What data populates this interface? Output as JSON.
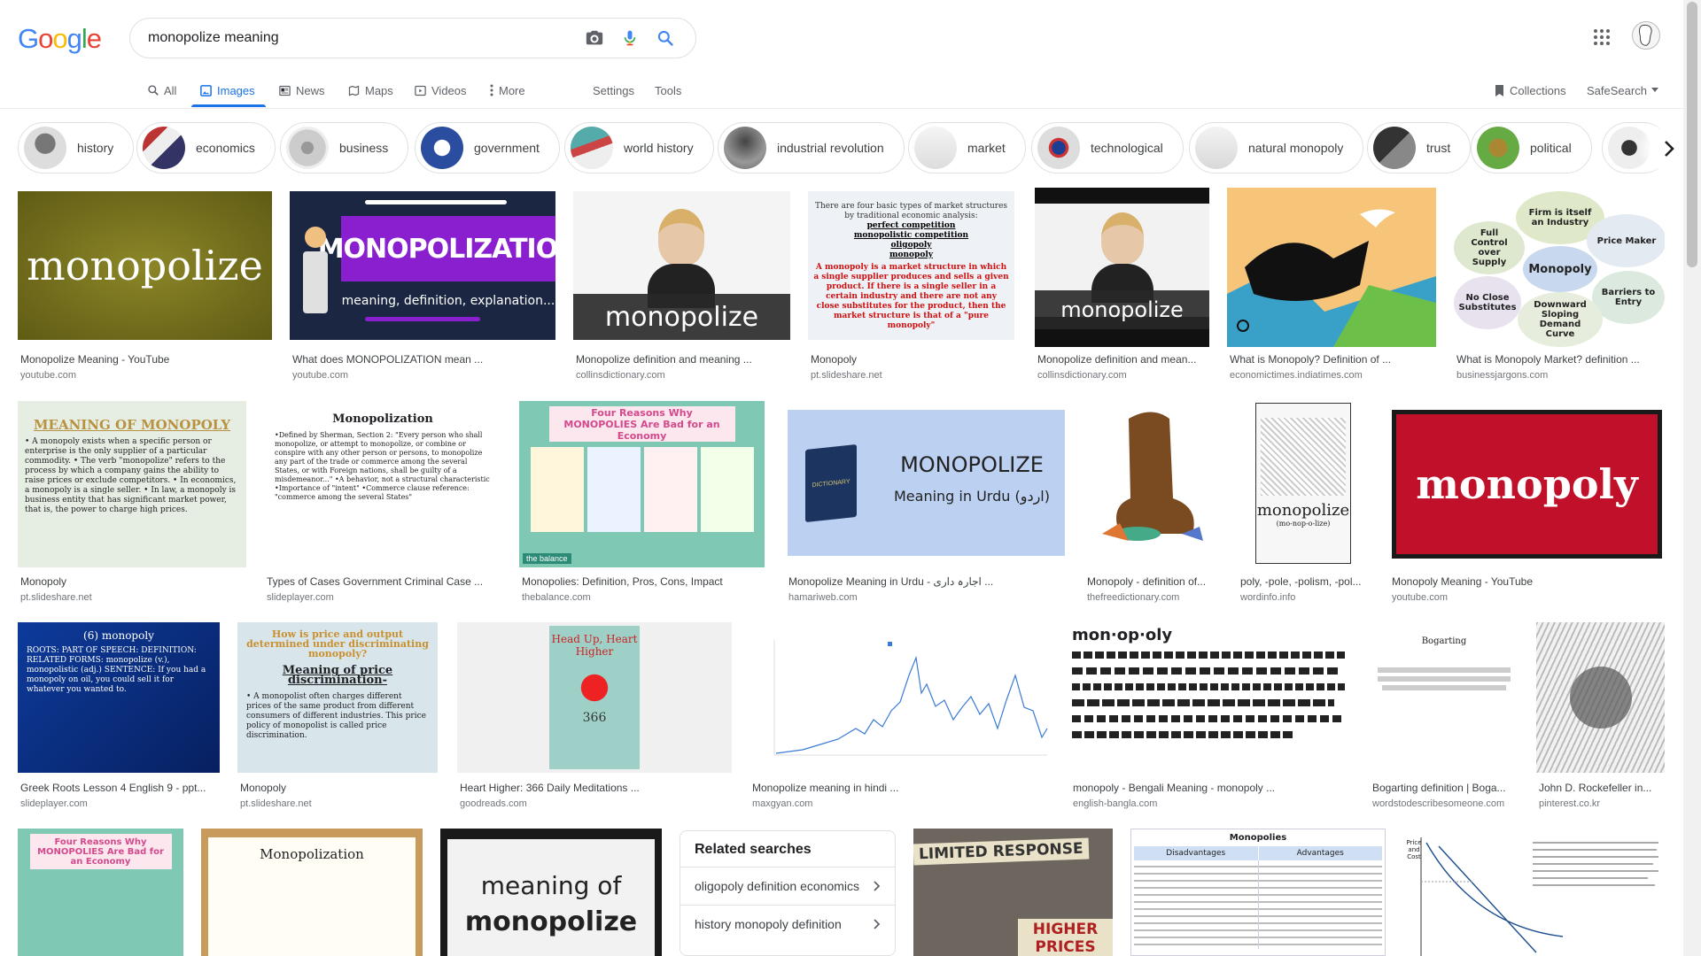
{
  "logo": {
    "text": "Google"
  },
  "search": {
    "query": "monopolize meaning"
  },
  "tabs": {
    "all": "All",
    "images": "Images",
    "news": "News",
    "maps": "Maps",
    "videos": "Videos",
    "more": "More",
    "settings": "Settings",
    "tools": "Tools",
    "collections": "Collections",
    "safesearch": "SafeSearch"
  },
  "chips": [
    "history",
    "economics",
    "business",
    "government",
    "world history",
    "industrial revolution",
    "market",
    "technological",
    "natural monopoly",
    "trust",
    "political"
  ],
  "results": [
    {
      "title": "Monopolize Meaning - YouTube",
      "domain": "youtube.com",
      "caption": "monopolize"
    },
    {
      "title": "What does MONOPOLIZATION mean ...",
      "domain": "youtube.com",
      "caption": "MONOPOLIZATION",
      "sub": "meaning, definition, explanation..."
    },
    {
      "title": "Monopolize definition and meaning ...",
      "domain": "collinsdictionary.com",
      "caption": "monopolize"
    },
    {
      "title": "Monopoly",
      "domain": "pt.slideshare.net",
      "caption": "There are four basic types of market structures by traditional economic analysis:",
      "lines": [
        "perfect competition",
        "monopolistic competition",
        "oligopoly",
        "monopoly"
      ],
      "body": "A monopoly is a market structure in which a single supplier produces and sells a given product. If there is a single seller in a certain industry and there are not any close substitutes for the product, then the market structure is that of a \"pure monopoly\""
    },
    {
      "title": "Monopolize definition and mean...",
      "domain": "collinsdictionary.com",
      "caption": "monopolize"
    },
    {
      "title": "What is Monopoly? Definition of ...",
      "domain": "economictimes.indiatimes.com"
    },
    {
      "title": "What is Monopoly Market? definition ...",
      "domain": "businessjargons.com",
      "center": "Monopoly",
      "bubbles": [
        "Firm is itself an Industry",
        "Price Maker",
        "Full Control over Supply",
        "No Close Substitutes",
        "Barriers to Entry",
        "Downward Sloping Demand Curve"
      ]
    },
    {
      "title": "Monopoly",
      "domain": "pt.slideshare.net",
      "caption": "MEANING OF MONOPOLY",
      "body": "• A monopoly exists when a specific person or enterprise is the only supplier of a particular commodity. • The verb \"monopolize\" refers to the process by which a company gains the ability to raise prices or exclude competitors. • In economics, a monopoly is a single seller. • In law, a monopoly is business entity that has significant market power, that is, the power to charge high prices."
    },
    {
      "title": "Types of Cases Government Criminal Case ...",
      "domain": "slideplayer.com",
      "caption": "Monopolization",
      "body": "•Defined by Sherman, Section 2: \"Every person who shall monopolize, or attempt to monopolize, or combine or conspire with any other person or persons, to monopolize any part of the trade or commerce among the several States, or with Foreign nations, shall be guilty of a misdemeanor...\" •A behavior, not a structural characteristic •Importance of \"intent\" •Commerce clause reference: \"commerce among the several States\""
    },
    {
      "title": "Monopolies: Definition, Pros, Cons, Impact",
      "domain": "thebalance.com",
      "caption": "Four Reasons Why MONOPOLIES Are Bad for an Economy",
      "footer": "the balance"
    },
    {
      "title": "Monopolize Meaning in Urdu - اجارہ داری ...",
      "domain": "hamariweb.com",
      "caption": "MONOPOLIZE",
      "sub": "Meaning in Urdu (اردو)",
      "book": "DICTIONARY"
    },
    {
      "title": "Monopoly - definition of...",
      "domain": "thefreedictionary.com"
    },
    {
      "title": "poly, -pole, -polism, -pol...",
      "domain": "wordinfo.info",
      "caption": "monopolize",
      "sub": "(mo-nop-o-lize)"
    },
    {
      "title": "Monopoly Meaning - YouTube",
      "domain": "youtube.com",
      "caption": "monopoly"
    },
    {
      "title": "Greek Roots Lesson 4 English 9 - ppt...",
      "domain": "slideplayer.com",
      "caption": "(6) monopoly",
      "body": "ROOTS: PART OF SPEECH: DEFINITION: RELATED FORMS: monopolize (v.), monopolistic (adj.) SENTENCE: If you had a monopoly on oil, you could sell it for whatever you wanted to."
    },
    {
      "title": "Monopoly",
      "domain": "pt.slideshare.net",
      "caption": "How is price and output determined under discriminating monopoly?",
      "sub": "Meaning of price discrimination-",
      "body": "• A monopolist often charges different prices of the same product from different consumers of different industries. This price policy of monopolist is called price discrimination."
    },
    {
      "title": "Heart Higher: 366 Daily Meditations ...",
      "domain": "goodreads.com",
      "caption": "Head Up, Heart Higher",
      "sub": "366"
    },
    {
      "title": "Monopolize meaning in hindi ...",
      "domain": "maxgyan.com"
    },
    {
      "title": "monopoly - Bengali Meaning - monopoly ...",
      "domain": "english-bangla.com",
      "caption": "mon·op·oly"
    },
    {
      "title": "Bogarting definition | Boga...",
      "domain": "wordstodescribesomeone.com",
      "caption": "Bogarting"
    },
    {
      "title": "John D. Rockefeller in...",
      "domain": "pinterest.co.kr"
    },
    {
      "caption": "Four Reasons Why MONOPOLIES Are Bad for an Economy"
    },
    {
      "caption": "Monopolization"
    },
    {
      "caption": "meaning of",
      "sub": "monopolize"
    },
    {
      "caption": "LIMITED RESPONSE",
      "sub": "HIGHER PRICES"
    },
    {
      "caption": "Monopolies",
      "cols": [
        "Disadvantages",
        "Advantages"
      ]
    },
    {
      "caption": "Price and Cost"
    }
  ],
  "related": {
    "heading": "Related searches",
    "items": [
      "oligopoly definition economics",
      "history monopoly definition"
    ]
  },
  "colors": {
    "accent": "#1a73e8",
    "logo_blue": "#4285f4",
    "logo_red": "#ea4335",
    "logo_yellow": "#fbbc05",
    "logo_green": "#34a853"
  }
}
